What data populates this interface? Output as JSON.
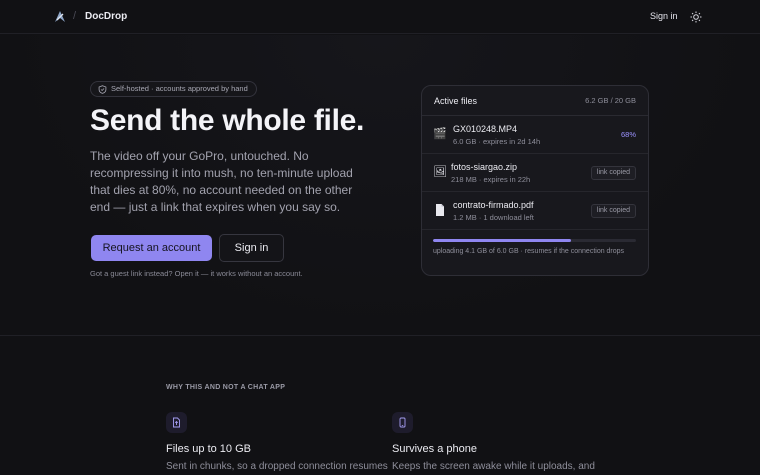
{
  "header": {
    "brand": "DocDrop",
    "separator": "/",
    "signin_label": "Sign in",
    "icons": [
      "logo-icon",
      "theme-toggle-icon"
    ]
  },
  "hero": {
    "pill": "Self-hosted · accounts approved by hand",
    "headline": "Send the whole file.",
    "lede": "The video off your GoPro, untouched. No recompressing it into mush, no ten-minute upload that dies at 80%, no account needed on the other end — just a link that expires when you say so.",
    "primary_button": "Request an account",
    "secondary_button": "Sign in",
    "guest_note": "Got a guest link instead? Open it — it works without an account."
  },
  "active_files": {
    "title": "Active files",
    "quota": "6.2 GB / 20 GB",
    "files": [
      {
        "icon": "video-icon",
        "name": "GX010248.MP4",
        "meta": "6.0 GB · expires in 2d 14h",
        "status": "68%"
      },
      {
        "icon": "image-icon",
        "name": "fotos-siargao.zip",
        "meta": "218 MB · expires in 22h",
        "status": "link copied"
      },
      {
        "icon": "document-icon",
        "name": "contrato-firmado.pdf",
        "meta": "1.2 MB · 1 download left",
        "status": "link copied"
      }
    ],
    "upload_progress": 0.68,
    "upload_text": "uploading 4.1 GB of 6.0 GB · resumes if the connection drops"
  },
  "why": {
    "label": "WHY THIS AND NOT A CHAT APP",
    "features": [
      {
        "icon": "file-upload-icon",
        "title": "Files up to 10 GB",
        "body": "Sent in chunks, so a dropped connection resumes"
      },
      {
        "icon": "phone-icon",
        "title": "Survives a phone",
        "body": "Keeps the screen awake while it uploads, and"
      }
    ]
  },
  "colors": {
    "accent": "#8f86f0",
    "background": "#111114",
    "card": "#18181d"
  }
}
